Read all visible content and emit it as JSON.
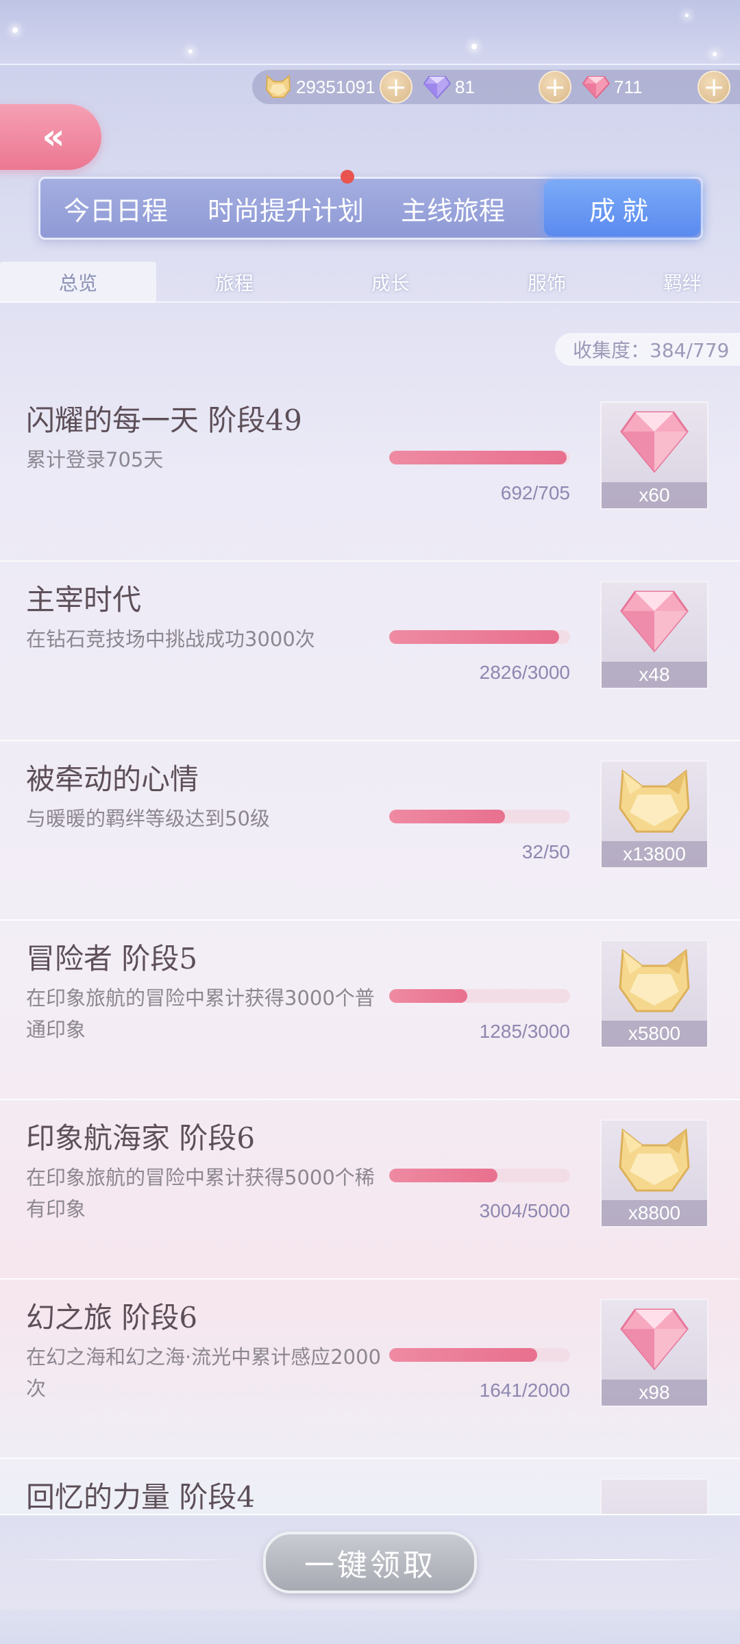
{
  "currency": {
    "gold": "29351091",
    "diamond": "81",
    "pink_diamond": "711",
    "plus_symbol": "+"
  },
  "back_symbol": "«",
  "main_tabs": [
    {
      "label": "今日日程"
    },
    {
      "label": "时尚提升计划"
    },
    {
      "label": "主线旅程"
    },
    {
      "label": "成就"
    }
  ],
  "sub_tabs": [
    {
      "label": "总览"
    },
    {
      "label": "旅程"
    },
    {
      "label": "成长"
    },
    {
      "label": "服饰"
    },
    {
      "label": "羁绊"
    }
  ],
  "collection": "收集度：384/779",
  "achievements": [
    {
      "title": "闪耀的每一天 阶段49",
      "desc": "累计登录705天",
      "progress": "692/705",
      "fraction": 0.98,
      "reward_icon": "pink-diamond-icon",
      "reward_count": "x60"
    },
    {
      "title": "主宰时代",
      "desc": "在钻石竞技场中挑战成功3000次",
      "progress": "2826/3000",
      "fraction": 0.94,
      "reward_icon": "pink-diamond-icon",
      "reward_count": "x48"
    },
    {
      "title": "被牵动的心情",
      "desc": "与暖暖的羁绊等级达到50级",
      "progress": "32/50",
      "fraction": 0.64,
      "reward_icon": "gold-cat-icon",
      "reward_count": "x13800"
    },
    {
      "title": "冒险者 阶段5",
      "desc": "在印象旅航的冒险中累计获得3000个普通印象",
      "progress": "1285/3000",
      "fraction": 0.43,
      "reward_icon": "gold-cat-icon",
      "reward_count": "x5800"
    },
    {
      "title": "印象航海家 阶段6",
      "desc": "在印象旅航的冒险中累计获得5000个稀有印象",
      "progress": "3004/5000",
      "fraction": 0.6,
      "reward_icon": "gold-cat-icon",
      "reward_count": "x8800"
    },
    {
      "title": "幻之旅 阶段6",
      "desc": "在幻之海和幻之海·流光中累计感应2000次",
      "progress": "1641/2000",
      "fraction": 0.82,
      "reward_icon": "pink-diamond-icon",
      "reward_count": "x98"
    },
    {
      "title": "回忆的力量 阶段4"
    }
  ],
  "claim_all": "一键领取"
}
